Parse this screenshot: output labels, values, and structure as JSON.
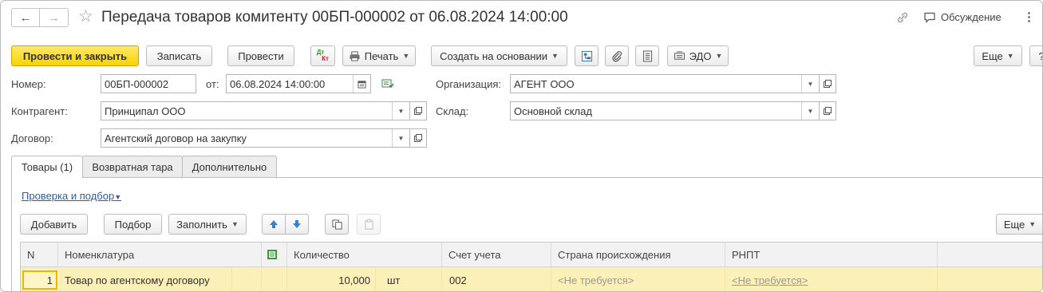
{
  "window": {
    "title": "Передача товаров комитенту 00БП-000002 от 06.08.2024 14:00:00",
    "discussion_label": "Обсуждение"
  },
  "toolbar": {
    "post_close": "Провести и закрыть",
    "save": "Записать",
    "post": "Провести",
    "dtkt_dt": "Дт",
    "dtkt_kt": "Кт",
    "print": "Печать",
    "create_based": "Создать на основании",
    "edo": "ЭДО",
    "more": "Еще",
    "help": "?"
  },
  "form": {
    "number_label": "Номер:",
    "number_value": "00БП-000002",
    "date_label": "от:",
    "date_value": "06.08.2024 14:00:00",
    "org_label": "Организация:",
    "org_value": "АГЕНТ ООО",
    "contractor_label": "Контрагент:",
    "contractor_value": "Принципал ООО",
    "warehouse_label": "Склад:",
    "warehouse_value": "Основной склад",
    "contract_label": "Договор:",
    "contract_value": "Агентский договор на закупку"
  },
  "tabs": [
    {
      "label": "Товары (1)",
      "active": true
    },
    {
      "label": "Возвратная тара",
      "active": false
    },
    {
      "label": "Дополнительно",
      "active": false
    }
  ],
  "goods": {
    "check_link": "Проверка и подбор",
    "add": "Добавить",
    "pick": "Подбор",
    "fill": "Заполнить",
    "more": "Еще",
    "columns": [
      "N",
      "Номенклатура",
      "",
      "Количество",
      "Счет учета",
      "Страна происхождения",
      "РНПТ"
    ],
    "rows": [
      {
        "n": "1",
        "item": "Товар по агентскому договору",
        "qty": "10,000",
        "unit": "шт",
        "account": "002",
        "country": "<Не требуется>",
        "rnpt": "<Не требуется>"
      }
    ]
  },
  "colors": {
    "primary_button": "#f6d400",
    "selected_row": "#fbf0b8",
    "link": "#2a5db0"
  }
}
